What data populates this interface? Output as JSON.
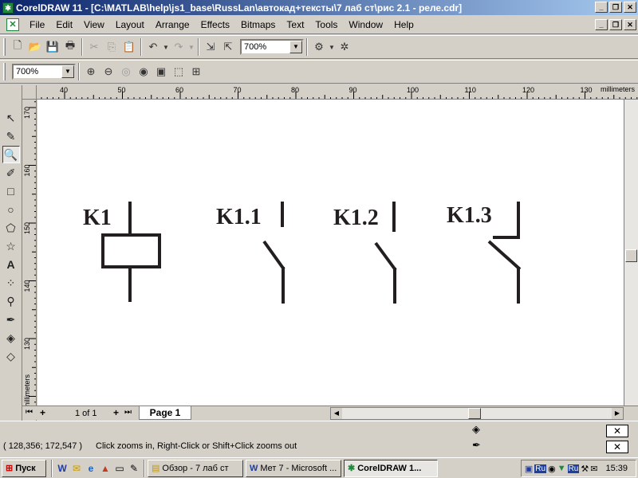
{
  "window": {
    "title": "CorelDRAW 11 - [C:\\MATLAB\\help\\js1_base\\RussLan\\автокад+тексты\\7 лаб ст\\рис 2.1 - реле.cdr]",
    "app_icon": "coreldraw-icon",
    "min_glyph": "_",
    "max_glyph": "❐",
    "close_glyph": "✕"
  },
  "menu": {
    "items": [
      "File",
      "Edit",
      "View",
      "Layout",
      "Arrange",
      "Effects",
      "Bitmaps",
      "Text",
      "Tools",
      "Window",
      "Help"
    ]
  },
  "toolbar": {
    "zoom_standard": "700%",
    "zoom_property": "700%"
  },
  "ruler": {
    "units": "millimeters",
    "h_ticks": [
      "40",
      "50",
      "60",
      "70",
      "80",
      "90",
      "100",
      "110",
      "120",
      "130"
    ],
    "v_ticks": [
      "170",
      "160",
      "150",
      "140",
      "130"
    ],
    "v_units": "millimeters"
  },
  "drawing": {
    "labels": [
      "K1",
      "K1.1",
      "K1.2",
      "K1.3"
    ]
  },
  "pages": {
    "counter": "1 of 1",
    "tab": "Page 1"
  },
  "status": {
    "coords": "( 128,356; 172,547 )",
    "hint": "Click zooms in, Right-Click or Shift+Click zooms out"
  },
  "taskbar": {
    "start": "Пуск",
    "tasks": [
      {
        "label": "Обзор - 7 лаб ст",
        "icon": "folder-icon"
      },
      {
        "label": "Мет 7 - Microsoft ...",
        "icon": "word-icon"
      },
      {
        "label": "CorelDRAW 1...",
        "icon": "coreldraw-icon"
      }
    ],
    "clock": "15:39",
    "lang1": "Ru",
    "lang2": "Ru"
  },
  "colors": {
    "title_start": "#0a246a",
    "title_end": "#a6caf0",
    "drawing_stroke": "#231f20"
  }
}
